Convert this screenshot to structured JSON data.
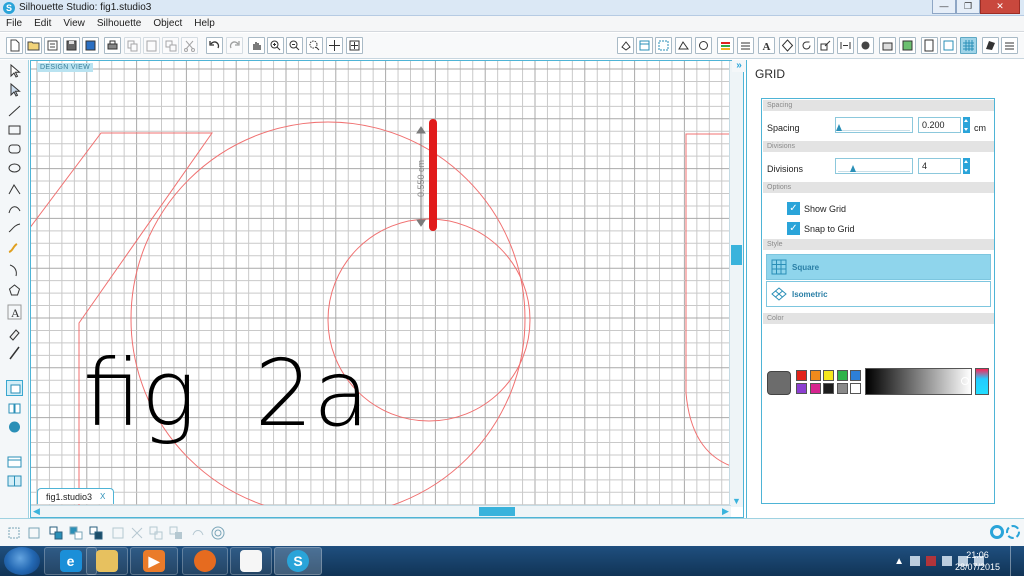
{
  "titlebar": {
    "title": "Silhouette Studio: fig1.studio3",
    "minimize_glyph": "—",
    "maximize_glyph": "❐",
    "close_glyph": "✕"
  },
  "menu": [
    "File",
    "Edit",
    "View",
    "Silhouette",
    "Object",
    "Help"
  ],
  "canvas": {
    "view_label": "DESIGN VIEW",
    "document_tab": "fig1.studio3",
    "close_tab_glyph": "X",
    "measure_label": "0.550 cm",
    "canvas_text": "fig  2a",
    "line_color": "#f07070",
    "highlight_color": "#e11b1b",
    "grid_color": "#c9c9c9"
  },
  "panel": {
    "collapse_glyph": "»",
    "title": "GRID",
    "sections": {
      "spacing": "Spacing",
      "divisions": "Divisions",
      "options": "Options",
      "style": "Style",
      "color": "Color"
    },
    "spacing": {
      "label": "Spacing",
      "value": "0.200",
      "unit": "cm"
    },
    "divisions": {
      "label": "Divisions",
      "value": "4"
    },
    "options": {
      "show_grid": "Show Grid",
      "snap_to_grid": "Snap to Grid",
      "check_glyph": "✓"
    },
    "style": {
      "square": "Square",
      "isometric": "Isometric",
      "selected": "Square"
    },
    "swatches": [
      "#e2231a",
      "#f08a1c",
      "#f6e71d",
      "#2fb34a",
      "#2d7fd8",
      "#8c3fd1",
      "#d6248f",
      "#1c1c1c",
      "#8a8a8a",
      "#ffffff"
    ],
    "main_swatch": "#6c6c6c"
  },
  "scroll": {
    "up": "▲",
    "down": "▼",
    "left": "◀",
    "right": "▶"
  },
  "taskbar": {
    "time": "21:06",
    "date": "28/07/2015",
    "apps": [
      "internet-explorer",
      "file-explorer",
      "media-player",
      "firefox",
      "feather-app",
      "silhouette-studio"
    ]
  }
}
